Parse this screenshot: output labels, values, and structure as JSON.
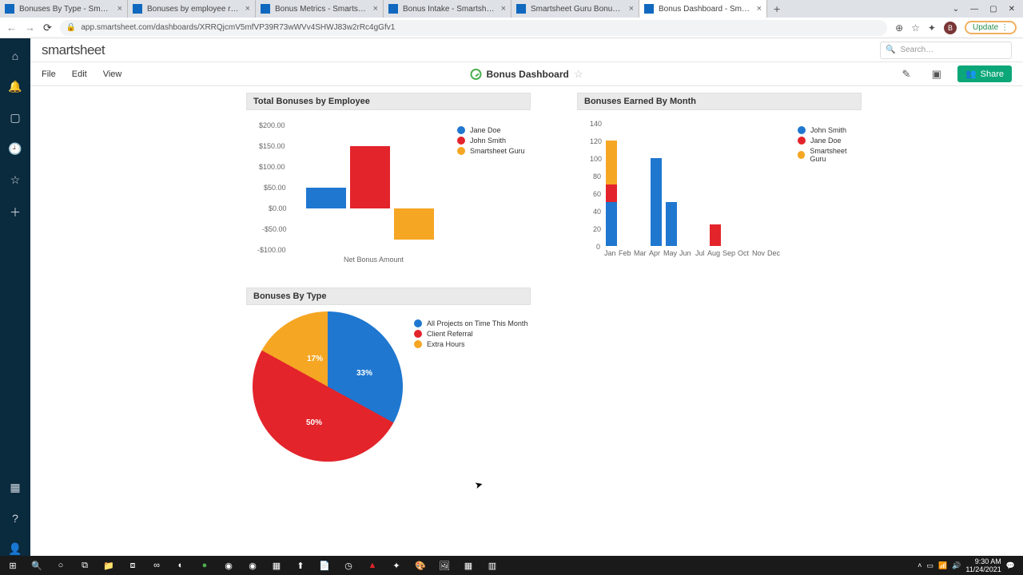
{
  "browser": {
    "tabs": [
      {
        "title": "Bonuses By Type - Smartsheet.co"
      },
      {
        "title": "Bonuses by employee report - S"
      },
      {
        "title": "Bonus Metrics - Smartsheet.com"
      },
      {
        "title": "Bonus Intake - Smartsheet.com"
      },
      {
        "title": "Smartsheet Guru Bonus Entry Fo"
      },
      {
        "title": "Bonus Dashboard - Smartsheet"
      }
    ],
    "url": "app.smartsheet.com/dashboards/XRRQjcmV5mfVP39R73wWVv4SHWJ83w2rRc4gGfv1",
    "update_label": "Update",
    "avatar_letter": "B"
  },
  "app": {
    "brand": "smartsheet",
    "search_placeholder": "Search…",
    "menus": {
      "file": "File",
      "edit": "Edit",
      "view": "View"
    },
    "title": "Bonus Dashboard",
    "share_label": "Share"
  },
  "widgets": {
    "w1_title": "Total Bonuses by Employee",
    "w2_title": "Bonuses Earned By Month",
    "w3_title": "Bonuses By Type"
  },
  "chart_data": [
    {
      "type": "bar",
      "title": "Total Bonuses by Employee",
      "xlabel": "Net Bonus Amount",
      "ylabel": "",
      "ylim": [
        -100,
        200
      ],
      "y_ticks": [
        "$200.00",
        "$150.00",
        "$100.00",
        "$50.00",
        "$0.00",
        "-$50.00",
        "-$100.00"
      ],
      "series": [
        {
          "name": "Jane Doe",
          "value": 50,
          "color": "#1f77d0"
        },
        {
          "name": "John Smith",
          "value": 150,
          "color": "#e3242b"
        },
        {
          "name": "Smartsheet Guru",
          "value": -75,
          "color": "#f5a623"
        }
      ]
    },
    {
      "type": "bar",
      "title": "Bonuses Earned By Month",
      "ylim": [
        0,
        140
      ],
      "y_ticks": [
        "140",
        "120",
        "100",
        "80",
        "60",
        "40",
        "20",
        "0"
      ],
      "categories": [
        "Jan",
        "Feb",
        "Mar",
        "Apr",
        "May",
        "Jun",
        "Jul",
        "Aug",
        "Sep",
        "Oct",
        "Nov",
        "Dec"
      ],
      "legend": [
        {
          "name": "John Smith",
          "color": "#1f77d0"
        },
        {
          "name": "Jane Doe",
          "color": "#e3242b"
        },
        {
          "name": "Smartsheet Guru",
          "color": "#f5a623"
        }
      ],
      "stacks": {
        "Jan": [
          {
            "name": "John Smith",
            "v": 50
          },
          {
            "name": "Jane Doe",
            "v": 20
          },
          {
            "name": "Smartsheet Guru",
            "v": 50
          }
        ],
        "Apr": [
          {
            "name": "John Smith",
            "v": 100
          }
        ],
        "May": [
          {
            "name": "John Smith",
            "v": 50
          }
        ],
        "Aug": [
          {
            "name": "Jane Doe",
            "v": 25
          }
        ]
      }
    },
    {
      "type": "pie",
      "title": "Bonuses By Type",
      "slices": [
        {
          "name": "All Projects on Time This Month",
          "pct": 33,
          "label": "33%",
          "color": "#1f77d0"
        },
        {
          "name": "Client Referral",
          "pct": 50,
          "label": "50%",
          "color": "#e3242b"
        },
        {
          "name": "Extra Hours",
          "pct": 17,
          "label": "17%",
          "color": "#f5a623"
        }
      ]
    }
  ],
  "taskbar": {
    "clock_time": "9:30 AM",
    "clock_date": "11/24/2021"
  }
}
